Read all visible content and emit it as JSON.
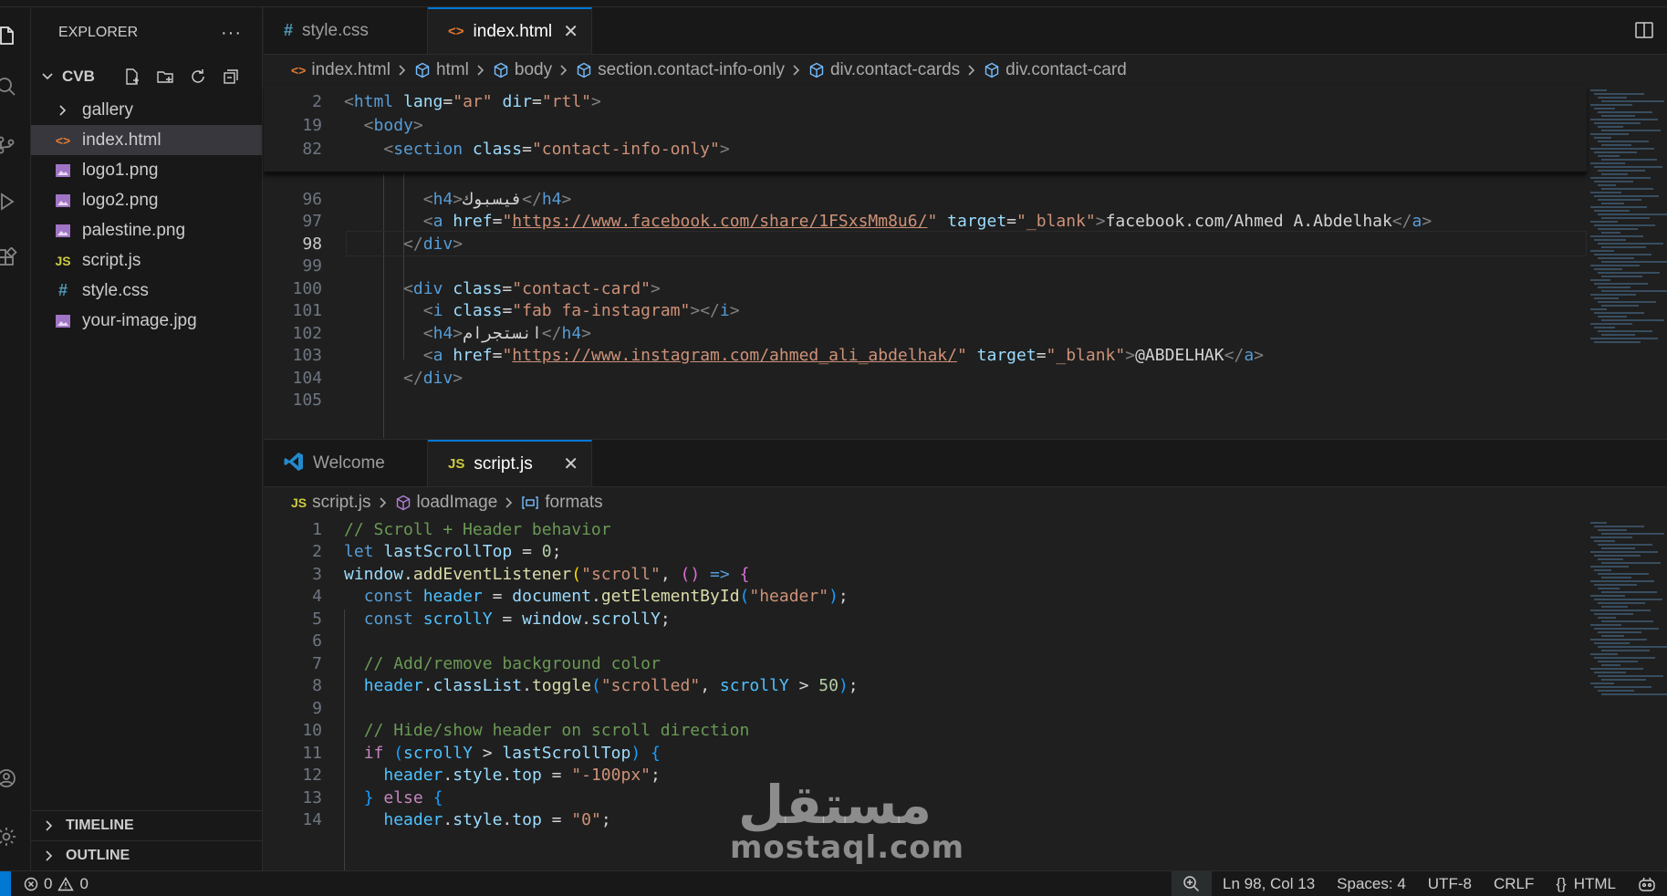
{
  "explorer": {
    "title": "EXPLORER",
    "more": "···",
    "folder": "CVB",
    "items": [
      {
        "label": "gallery",
        "kind": "folder"
      },
      {
        "label": "index.html",
        "kind": "html",
        "selected": true
      },
      {
        "label": "logo1.png",
        "kind": "image"
      },
      {
        "label": "logo2.png",
        "kind": "image"
      },
      {
        "label": "palestine.png",
        "kind": "image"
      },
      {
        "label": "script.js",
        "kind": "js"
      },
      {
        "label": "style.css",
        "kind": "css"
      },
      {
        "label": "your-image.jpg",
        "kind": "image"
      }
    ],
    "timeline": "TIMELINE",
    "outline": "OUTLINE"
  },
  "top_group": {
    "tabs": [
      {
        "label": "style.css",
        "icon": "#",
        "active": false
      },
      {
        "label": "index.html",
        "icon": "<>",
        "active": true,
        "close": "✕"
      }
    ],
    "breadcrumb": [
      "index.html",
      "html",
      "body",
      "section.contact-info-only",
      "div.contact-cards",
      "div.contact-card"
    ],
    "sticky_lines": [
      {
        "n": "2",
        "html": "<html lang=\"ar\" dir=\"rtl\">"
      },
      {
        "n": "19",
        "html": "<body>"
      },
      {
        "n": "82",
        "html": "<section class=\"contact-info-only\">"
      }
    ],
    "lines": [
      {
        "n": "96",
        "indent": 4,
        "kind": "h4",
        "text": "فيسبوك"
      },
      {
        "n": "97",
        "indent": 4,
        "kind": "a",
        "href": "https://www.facebook.com/share/1FSxsMm8u6/",
        "target": "_blank",
        "text": "facebook.com/Ahmed A.Abdelhak"
      },
      {
        "n": "98",
        "indent": 3,
        "kind": "close_div",
        "current": true
      },
      {
        "n": "99",
        "indent": 0,
        "kind": "blank"
      },
      {
        "n": "100",
        "indent": 3,
        "kind": "div",
        "class": "contact-card"
      },
      {
        "n": "101",
        "indent": 4,
        "kind": "i",
        "class": "fab fa-instagram"
      },
      {
        "n": "102",
        "indent": 4,
        "kind": "h4",
        "text": "انستجرام"
      },
      {
        "n": "103",
        "indent": 4,
        "kind": "a",
        "href": "https://www.instagram.com/ahmed_ali_abdelhak/",
        "target": "_blank",
        "text": "@ABDELHAK"
      },
      {
        "n": "104",
        "indent": 3,
        "kind": "close_div"
      },
      {
        "n": "105",
        "indent": 0,
        "kind": "blank"
      }
    ]
  },
  "bottom_group": {
    "tabs": [
      {
        "label": "Welcome",
        "icon": "vscode",
        "active": false
      },
      {
        "label": "script.js",
        "icon": "JS",
        "active": true,
        "close": "✕"
      }
    ],
    "breadcrumb": [
      "script.js",
      "loadImage",
      "formats"
    ],
    "lines": [
      {
        "n": "1",
        "tokens": [
          [
            "cm",
            "// Scroll + Header behavior"
          ]
        ]
      },
      {
        "n": "2",
        "tokens": [
          [
            "kw",
            "let "
          ],
          [
            "var",
            "lastScrollTop"
          ],
          [
            "txt",
            " = "
          ],
          [
            "num",
            "0"
          ],
          [
            "txt",
            ";"
          ]
        ]
      },
      {
        "n": "3",
        "tokens": [
          [
            "var",
            "window"
          ],
          [
            "txt",
            "."
          ],
          [
            "fn",
            "addEventListener"
          ],
          [
            "bk1",
            "("
          ],
          [
            "str",
            "\"scroll\""
          ],
          [
            "txt",
            ", "
          ],
          [
            "bk2",
            "("
          ],
          [
            "bk2",
            ")"
          ],
          [
            "txt",
            " "
          ],
          [
            "kw",
            "=>"
          ],
          [
            "txt",
            " "
          ],
          [
            "bk2",
            "{"
          ]
        ]
      },
      {
        "n": "4",
        "tokens": [
          [
            "txt",
            "  "
          ],
          [
            "kw",
            "const "
          ],
          [
            "const",
            "header"
          ],
          [
            "txt",
            " = "
          ],
          [
            "var",
            "document"
          ],
          [
            "txt",
            "."
          ],
          [
            "fn",
            "getElementById"
          ],
          [
            "bk3",
            "("
          ],
          [
            "str",
            "\"header\""
          ],
          [
            "bk3",
            ")"
          ],
          [
            "txt",
            ";"
          ]
        ]
      },
      {
        "n": "5",
        "tokens": [
          [
            "txt",
            "  "
          ],
          [
            "kw",
            "const "
          ],
          [
            "const",
            "scrollY"
          ],
          [
            "txt",
            " = "
          ],
          [
            "var",
            "window"
          ],
          [
            "txt",
            "."
          ],
          [
            "var",
            "scrollY"
          ],
          [
            "txt",
            ";"
          ]
        ]
      },
      {
        "n": "6",
        "tokens": []
      },
      {
        "n": "7",
        "tokens": [
          [
            "txt",
            "  "
          ],
          [
            "cm",
            "// Add/remove background color"
          ]
        ]
      },
      {
        "n": "8",
        "tokens": [
          [
            "txt",
            "  "
          ],
          [
            "const",
            "header"
          ],
          [
            "txt",
            "."
          ],
          [
            "var",
            "classList"
          ],
          [
            "txt",
            "."
          ],
          [
            "fn",
            "toggle"
          ],
          [
            "bk3",
            "("
          ],
          [
            "str",
            "\"scrolled\""
          ],
          [
            "txt",
            ", "
          ],
          [
            "const",
            "scrollY"
          ],
          [
            "txt",
            " > "
          ],
          [
            "num",
            "50"
          ],
          [
            "bk3",
            ")"
          ],
          [
            "txt",
            ";"
          ]
        ]
      },
      {
        "n": "9",
        "tokens": []
      },
      {
        "n": "10",
        "tokens": [
          [
            "txt",
            "  "
          ],
          [
            "cm",
            "// Hide/show header on scroll direction"
          ]
        ]
      },
      {
        "n": "11",
        "tokens": [
          [
            "txt",
            "  "
          ],
          [
            "ctl",
            "if "
          ],
          [
            "bk3",
            "("
          ],
          [
            "const",
            "scrollY"
          ],
          [
            "txt",
            " > "
          ],
          [
            "var",
            "lastScrollTop"
          ],
          [
            "bk3",
            ")"
          ],
          [
            "txt",
            " "
          ],
          [
            "bk3",
            "{"
          ]
        ]
      },
      {
        "n": "12",
        "tokens": [
          [
            "txt",
            "    "
          ],
          [
            "const",
            "header"
          ],
          [
            "txt",
            "."
          ],
          [
            "var",
            "style"
          ],
          [
            "txt",
            "."
          ],
          [
            "var",
            "top"
          ],
          [
            "txt",
            " = "
          ],
          [
            "str",
            "\"-100px\""
          ],
          [
            "txt",
            ";"
          ]
        ]
      },
      {
        "n": "13",
        "tokens": [
          [
            "txt",
            "  "
          ],
          [
            "bk3",
            "}"
          ],
          [
            "txt",
            " "
          ],
          [
            "ctl",
            "else "
          ],
          [
            "bk3",
            "{"
          ]
        ]
      },
      {
        "n": "14",
        "tokens": [
          [
            "txt",
            "    "
          ],
          [
            "const",
            "header"
          ],
          [
            "txt",
            "."
          ],
          [
            "var",
            "style"
          ],
          [
            "txt",
            "."
          ],
          [
            "var",
            "top"
          ],
          [
            "txt",
            " = "
          ],
          [
            "str",
            "\"0\""
          ],
          [
            "txt",
            ";"
          ]
        ]
      }
    ]
  },
  "status": {
    "errors": "0",
    "warnings": "0",
    "position": "Ln 98, Col 13",
    "spaces": "Spaces: 4",
    "encoding": "UTF-8",
    "eol": "CRLF",
    "language": "HTML",
    "language_icon": "{}"
  },
  "watermark": {
    "arabic": "مستقل",
    "latin": "mostaql.com"
  },
  "colors": {
    "accent": "#0078d4",
    "background": "#1f1f1f",
    "sidebar": "#181818"
  }
}
